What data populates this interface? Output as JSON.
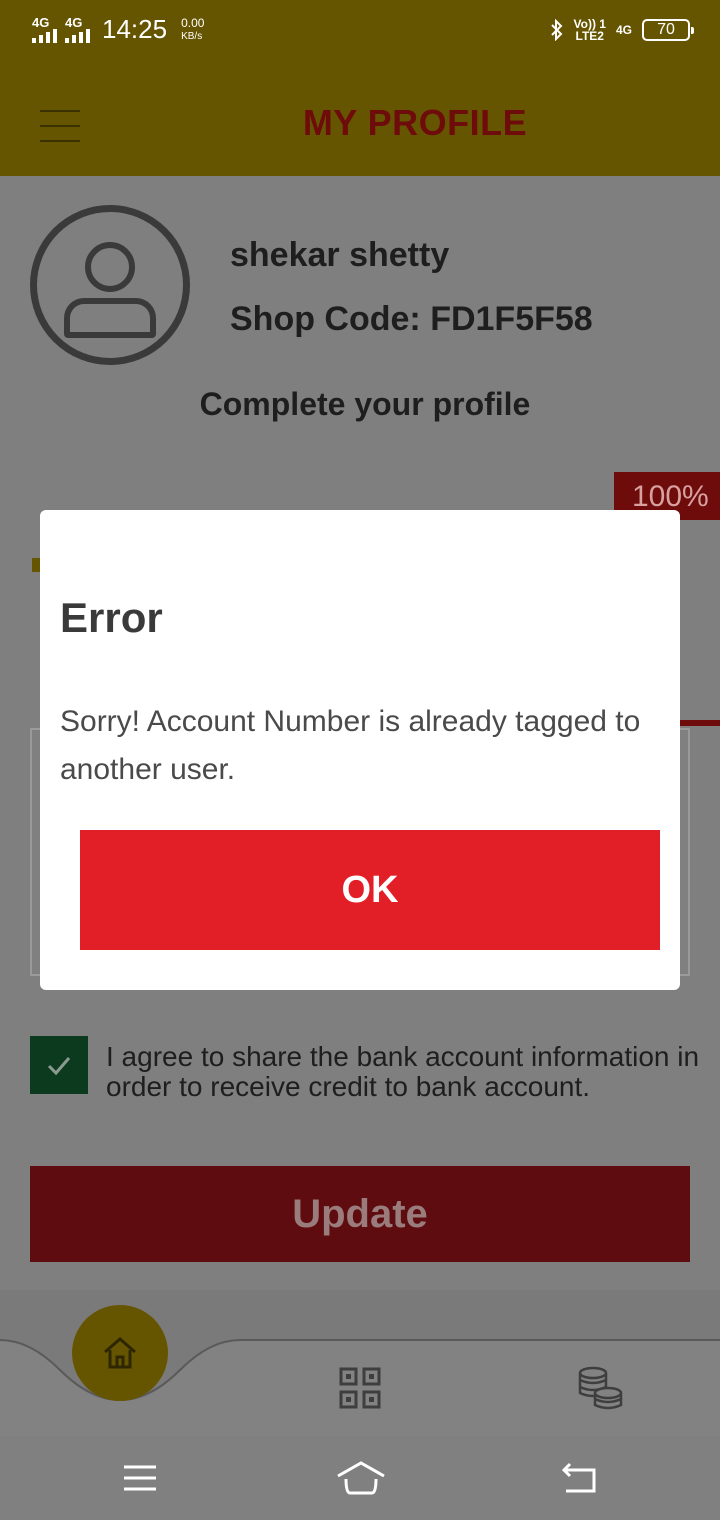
{
  "status_bar": {
    "signal1_label": "4G",
    "signal2_label": "4G",
    "time": "14:25",
    "speed_value": "0.00",
    "speed_unit": "KB/s",
    "volte_line1": "Vo)) 1",
    "volte_line2": "LTE2",
    "network_right": "4G",
    "battery": "70"
  },
  "header": {
    "title": "MY PROFILE"
  },
  "profile": {
    "name": "shekar shetty",
    "shop_code": "Shop Code: FD1F5F58",
    "complete_prompt": "Complete your profile",
    "progress_percent": "100%"
  },
  "agreement": {
    "checked": true,
    "text": "I agree to share the bank account information in order to receive credit to bank account."
  },
  "update_button": {
    "label": "Update"
  },
  "dialog": {
    "title": "Error",
    "message": "Sorry! Account Number is already tagged to another user.",
    "ok_label": "OK"
  },
  "colors": {
    "brand_yellow": "#FFD500",
    "brand_red": "#E21E26",
    "scrim_header": "#665500",
    "check_green": "#0B3A1E"
  },
  "icons": {
    "menu": "hamburger-icon",
    "avatar": "user-icon",
    "home": "home-icon",
    "qr": "qr-code-icon",
    "coins": "coins-icon",
    "check": "check-icon"
  }
}
